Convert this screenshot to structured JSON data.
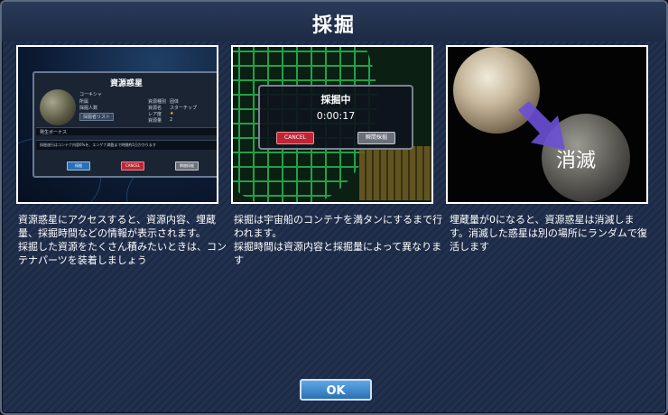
{
  "dialog": {
    "title": "採掘",
    "ok_label": "OK"
  },
  "panels": [
    {
      "window_title": "資源惑星",
      "planet_name": "コーキシャ",
      "rows_left": [
        "所属",
        "採掘人数"
      ],
      "rows_right": [
        "資源種別",
        "資源名",
        "レア度",
        "資源量"
      ],
      "values_right": [
        "固体",
        "スターチップ",
        "★",
        "2"
      ],
      "list_button": "採掘者リスト",
      "bonus_label": "発生ボーナス",
      "note": "採掘遂行はコンテナ内容6%を、エンゲナ満載まで時間約1日かかります",
      "buttons": [
        "採掘",
        "CANCEL",
        "瞬間採掘"
      ],
      "caption": [
        "資源惑星にアクセスすると、資源内容、埋蔵量、採掘時間などの情報が表示されます。",
        "採掘した資源をたくさん積みたいときは、コンテナパーツを装着しましょう"
      ]
    },
    {
      "window_title": "採掘中",
      "timer": "0:00:17",
      "buttons": [
        "CANCEL",
        "瞬間採掘"
      ],
      "caption": [
        "採掘は宇宙船のコンテナを満タンにするまで行われます。",
        "採掘時間は資源内容と採掘量によって異なります"
      ]
    },
    {
      "label": "消滅",
      "caption": [
        "埋蔵量が0になると、資源惑星は消滅します。消滅した惑星は別の場所にランダムで復活します"
      ]
    }
  ],
  "colors": {
    "accent_blue": "#2b6fb4",
    "cancel_red": "#c02535",
    "arrow_purple": "#6b4fd6"
  }
}
